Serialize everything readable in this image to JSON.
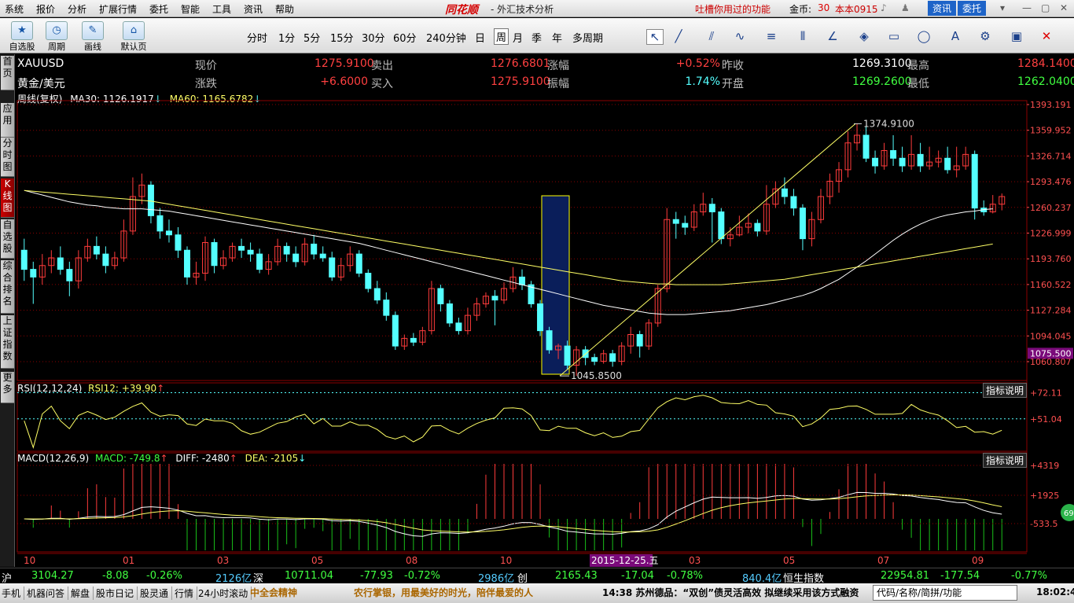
{
  "menubar": {
    "items": [
      "系统",
      "报价",
      "分析",
      "扩展行情",
      "委托",
      "智能",
      "工具",
      "资讯",
      "帮助"
    ],
    "brand": "同花顺",
    "title": "- 外汇技术分析",
    "tip": "吐槽你用过的功能",
    "gold_label": "金币:",
    "gold_value": "30",
    "user": "本本0915",
    "news_btn": "资讯",
    "trade_btn": "委托"
  },
  "toolbar": {
    "left_btns": [
      "自选股",
      "周期",
      "画线",
      "默认页"
    ],
    "periods": [
      "分时",
      "1分",
      "5分",
      "15分",
      "30分",
      "60分",
      "240分钟",
      "日",
      "周",
      "月",
      "季",
      "年",
      "多周期"
    ],
    "selected_period": "周"
  },
  "sidebar": {
    "tabs": [
      "首页",
      "应用",
      "分时图",
      "K线图",
      "自选股",
      "综合排名",
      "上证指数",
      "更多"
    ],
    "active": "K线图"
  },
  "quote": {
    "code": "XAUUSD",
    "name": "黄金/美元",
    "labels": [
      "现价",
      "涨跌",
      "卖出",
      "买入",
      "涨幅",
      "振幅",
      "昨收",
      "开盘",
      "最高",
      "最低"
    ],
    "current": "1275.9100",
    "change": "+6.6000",
    "sell": "1276.6801",
    "buy": "1275.9100",
    "pct": "+0.52%",
    "amplitude": "1.74%",
    "prev_close": "1269.3100",
    "open": "1269.2600",
    "high": "1284.1400",
    "low": "1262.0400"
  },
  "indicators": {
    "main": "周线(复权)",
    "ma30": "MA30: 1126.1917",
    "ma60": "MA60: 1165.6782",
    "rsi_title": "RSI(12,12,24)",
    "rsi12": "RSI12: +39.90",
    "macd_title": "MACD(12,26,9)",
    "macd": "MACD: -749.8",
    "diff": "DIFF: -2480",
    "dea": "DEA: -2105",
    "help": "指标说明"
  },
  "chart_data": {
    "type": "candlestick",
    "price_axis": [
      "1393.191",
      "1359.952",
      "1326.714",
      "1293.476",
      "1260.237",
      "1226.999",
      "1193.760",
      "1160.522",
      "1127.284",
      "1094.045",
      "1060.807"
    ],
    "current_price": "1075.500",
    "high_mark": "1374.9100",
    "low_mark": "1045.8500",
    "rsi_axis": [
      "+72.11",
      "+51.04"
    ],
    "macd_axis": [
      "+4319",
      "+1925",
      "-533.5"
    ],
    "x_labels": [
      "10",
      "01",
      "03",
      "05",
      "08",
      "10",
      "2015-12-25.五",
      "03",
      "05",
      "07",
      "09"
    ],
    "ylim": [
      1040,
      1400
    ],
    "candles": [
      [
        1210,
        1185,
        1225,
        1170
      ],
      [
        1185,
        1175,
        1195,
        1140
      ],
      [
        1175,
        1190,
        1205,
        1165
      ],
      [
        1190,
        1200,
        1210,
        1180
      ],
      [
        1200,
        1185,
        1215,
        1178
      ],
      [
        1185,
        1170,
        1195,
        1150
      ],
      [
        1170,
        1200,
        1210,
        1160
      ],
      [
        1200,
        1215,
        1225,
        1195
      ],
      [
        1215,
        1205,
        1228,
        1198
      ],
      [
        1205,
        1190,
        1215,
        1180
      ],
      [
        1190,
        1200,
        1208,
        1185
      ],
      [
        1200,
        1235,
        1250,
        1195
      ],
      [
        1235,
        1280,
        1305,
        1230
      ],
      [
        1280,
        1295,
        1310,
        1270
      ],
      [
        1295,
        1255,
        1300,
        1245
      ],
      [
        1255,
        1235,
        1265,
        1225
      ],
      [
        1235,
        1230,
        1250,
        1220
      ],
      [
        1230,
        1210,
        1240,
        1200
      ],
      [
        1210,
        1175,
        1215,
        1165
      ],
      [
        1175,
        1180,
        1195,
        1165
      ],
      [
        1180,
        1220,
        1228,
        1170
      ],
      [
        1220,
        1190,
        1225,
        1180
      ],
      [
        1190,
        1200,
        1210,
        1185
      ],
      [
        1200,
        1215,
        1220,
        1195
      ],
      [
        1215,
        1210,
        1225,
        1200
      ],
      [
        1210,
        1205,
        1220,
        1195
      ],
      [
        1205,
        1185,
        1212,
        1180
      ],
      [
        1185,
        1195,
        1205,
        1178
      ],
      [
        1195,
        1215,
        1225,
        1190
      ],
      [
        1215,
        1205,
        1220,
        1195
      ],
      [
        1205,
        1195,
        1215,
        1188
      ],
      [
        1195,
        1218,
        1226,
        1190
      ],
      [
        1218,
        1205,
        1230,
        1198
      ],
      [
        1205,
        1200,
        1215,
        1195
      ],
      [
        1200,
        1175,
        1208,
        1170
      ],
      [
        1175,
        1190,
        1200,
        1170
      ],
      [
        1190,
        1205,
        1215,
        1182
      ],
      [
        1205,
        1180,
        1210,
        1175
      ],
      [
        1180,
        1160,
        1185,
        1155
      ],
      [
        1160,
        1145,
        1170,
        1140
      ],
      [
        1145,
        1125,
        1155,
        1118
      ],
      [
        1125,
        1085,
        1130,
        1080
      ],
      [
        1085,
        1095,
        1100,
        1080
      ],
      [
        1095,
        1090,
        1102,
        1085
      ],
      [
        1090,
        1105,
        1110,
        1086
      ],
      [
        1105,
        1160,
        1170,
        1100
      ],
      [
        1160,
        1140,
        1165,
        1130
      ],
      [
        1140,
        1115,
        1145,
        1110
      ],
      [
        1115,
        1105,
        1122,
        1100
      ],
      [
        1105,
        1125,
        1135,
        1100
      ],
      [
        1125,
        1140,
        1148,
        1118
      ],
      [
        1140,
        1150,
        1155,
        1135
      ],
      [
        1150,
        1145,
        1158,
        1112
      ],
      [
        1145,
        1160,
        1168,
        1140
      ],
      [
        1160,
        1175,
        1188,
        1155
      ],
      [
        1175,
        1165,
        1185,
        1158
      ],
      [
        1165,
        1140,
        1170,
        1135
      ],
      [
        1140,
        1105,
        1145,
        1098
      ],
      [
        1105,
        1080,
        1110,
        1075
      ],
      [
        1080,
        1085,
        1088,
        1068
      ],
      [
        1085,
        1060,
        1092,
        1055
      ],
      [
        1060,
        1080,
        1085,
        1046
      ],
      [
        1080,
        1070,
        1085,
        1060
      ],
      [
        1070,
        1065,
        1075,
        1060
      ],
      [
        1065,
        1075,
        1080,
        1062
      ],
      [
        1075,
        1065,
        1080,
        1058
      ],
      [
        1065,
        1085,
        1090,
        1060
      ],
      [
        1085,
        1100,
        1110,
        1075
      ],
      [
        1100,
        1085,
        1105,
        1070
      ],
      [
        1085,
        1115,
        1120,
        1080
      ],
      [
        1115,
        1160,
        1165,
        1110
      ],
      [
        1160,
        1250,
        1265,
        1155
      ],
      [
        1250,
        1245,
        1260,
        1225
      ],
      [
        1245,
        1240,
        1255,
        1230
      ],
      [
        1240,
        1260,
        1270,
        1235
      ],
      [
        1260,
        1270,
        1285,
        1255
      ],
      [
        1270,
        1260,
        1278,
        1220
      ],
      [
        1260,
        1225,
        1265,
        1218
      ],
      [
        1225,
        1230,
        1240,
        1215
      ],
      [
        1230,
        1240,
        1255,
        1228
      ],
      [
        1240,
        1245,
        1258,
        1232
      ],
      [
        1245,
        1235,
        1250,
        1228
      ],
      [
        1235,
        1270,
        1295,
        1230
      ],
      [
        1270,
        1290,
        1300,
        1265
      ],
      [
        1290,
        1280,
        1305,
        1270
      ],
      [
        1280,
        1265,
        1290,
        1255
      ],
      [
        1265,
        1225,
        1270,
        1210
      ],
      [
        1225,
        1250,
        1260,
        1215
      ],
      [
        1250,
        1280,
        1290,
        1245
      ],
      [
        1280,
        1300,
        1310,
        1270
      ],
      [
        1300,
        1315,
        1325,
        1285
      ],
      [
        1315,
        1350,
        1365,
        1305
      ],
      [
        1350,
        1360,
        1375,
        1340
      ],
      [
        1360,
        1330,
        1372,
        1325
      ],
      [
        1330,
        1320,
        1340,
        1310
      ],
      [
        1320,
        1340,
        1350,
        1315
      ],
      [
        1340,
        1330,
        1360,
        1320
      ],
      [
        1330,
        1320,
        1345,
        1312
      ],
      [
        1320,
        1335,
        1360,
        1315
      ],
      [
        1335,
        1320,
        1350,
        1312
      ],
      [
        1320,
        1325,
        1345,
        1315
      ],
      [
        1325,
        1330,
        1340,
        1318
      ],
      [
        1330,
        1315,
        1345,
        1310
      ],
      [
        1315,
        1320,
        1345,
        1305
      ],
      [
        1320,
        1335,
        1345,
        1315
      ],
      [
        1335,
        1265,
        1340,
        1250
      ],
      [
        1265,
        1260,
        1275,
        1255
      ],
      [
        1260,
        1270,
        1282,
        1258
      ],
      [
        1270,
        1280,
        1284,
        1262
      ]
    ],
    "ma30": [
      1288,
      1285,
      1282,
      1279,
      1276,
      1273,
      1271,
      1269,
      1268,
      1266,
      1265,
      1264,
      1264,
      1264,
      1263,
      1262,
      1261,
      1259,
      1257,
      1255,
      1253,
      1251,
      1249,
      1247,
      1245,
      1243,
      1241,
      1239,
      1237,
      1235,
      1233,
      1231,
      1229,
      1227,
      1225,
      1223,
      1221,
      1219,
      1216,
      1213,
      1210,
      1207,
      1204,
      1201,
      1198,
      1195,
      1192,
      1189,
      1186,
      1183,
      1180,
      1177,
      1174,
      1171,
      1168,
      1165,
      1162,
      1159,
      1156,
      1153,
      1150,
      1147,
      1144,
      1141,
      1138,
      1136,
      1134,
      1132,
      1130,
      1128,
      1127,
      1126,
      1126,
      1126,
      1127,
      1128,
      1129,
      1130,
      1131,
      1133,
      1135,
      1137,
      1139,
      1142,
      1145,
      1148,
      1151,
      1155,
      1160,
      1166,
      1172,
      1180,
      1188,
      1196,
      1205,
      1214,
      1223,
      1231,
      1238,
      1244,
      1249,
      1253,
      1256,
      1258,
      1260,
      1261,
      1263,
      1264
    ],
    "ma60": [
      1288,
      1287,
      1286,
      1285,
      1284,
      1283,
      1282,
      1281,
      1280,
      1279,
      1278,
      1277,
      1276,
      1275,
      1274,
      1272,
      1270,
      1268,
      1266,
      1264,
      1262,
      1260,
      1258,
      1256,
      1254,
      1252,
      1250,
      1248,
      1246,
      1244,
      1242,
      1240,
      1238,
      1236,
      1234,
      1232,
      1230,
      1228,
      1226,
      1224,
      1222,
      1220,
      1218,
      1216,
      1214,
      1212,
      1210,
      1208,
      1206,
      1204,
      1202,
      1200,
      1198,
      1196,
      1194,
      1192,
      1190,
      1188,
      1186,
      1184,
      1182,
      1180,
      1178,
      1176,
      1174,
      1172,
      1170,
      1169,
      1168,
      1167,
      1166,
      1166,
      1165,
      1165,
      1165,
      1165,
      1165,
      1165,
      1166,
      1167,
      1168,
      1169,
      1170,
      1171,
      1172,
      1174,
      1176,
      1178,
      1180,
      1182,
      1184,
      1186,
      1188,
      1190,
      1192,
      1194,
      1196,
      1198,
      1200,
      1202,
      1204,
      1206,
      1208,
      1210,
      1212,
      1214,
      1216,
      1218
    ]
  },
  "statusbar": {
    "sh_label": "沪",
    "sh_val": "3104.27",
    "sh_chg": "-8.08",
    "sh_pct": "-0.26%",
    "sh_amt": "2126亿",
    "sz_label": "深",
    "sz_val": "10711.04",
    "sz_chg": "-77.93",
    "sz_pct": "-0.72%",
    "sz_amt": "2986亿",
    "cy_label": "创",
    "cy_val": "2165.43",
    "cy_chg": "-17.04",
    "cy_pct": "-0.78%",
    "cy_amt": "840.4亿",
    "hs_label": "恒生指数",
    "hs_val": "22954.81",
    "hs_chg": "-177.54",
    "hs_pct": "-0.77%"
  },
  "bottombar": {
    "items": [
      "手机",
      "机器问答",
      "解盘",
      "股市日记",
      "股灵通",
      "行情",
      "24小时滚动"
    ],
    "ticker1": "中全会精神",
    "ticker2": "农行掌银，用最美好的时光，陪伴最爱的人",
    "ticker3": "14:38 苏州德品：“双创”债灵活高效 拟继续采用该方式融资",
    "search_text": "代码/名称/简拼/功能",
    "time": "18:02:41"
  },
  "colors": {
    "up": "#ff3b3b",
    "down": "#54ffff",
    "ma30": "#ffffff",
    "ma60": "#ffff66",
    "grid": "#8b0000",
    "axis_text": "#ff5050",
    "green": "#19c019",
    "yellow": "#ffff00"
  }
}
